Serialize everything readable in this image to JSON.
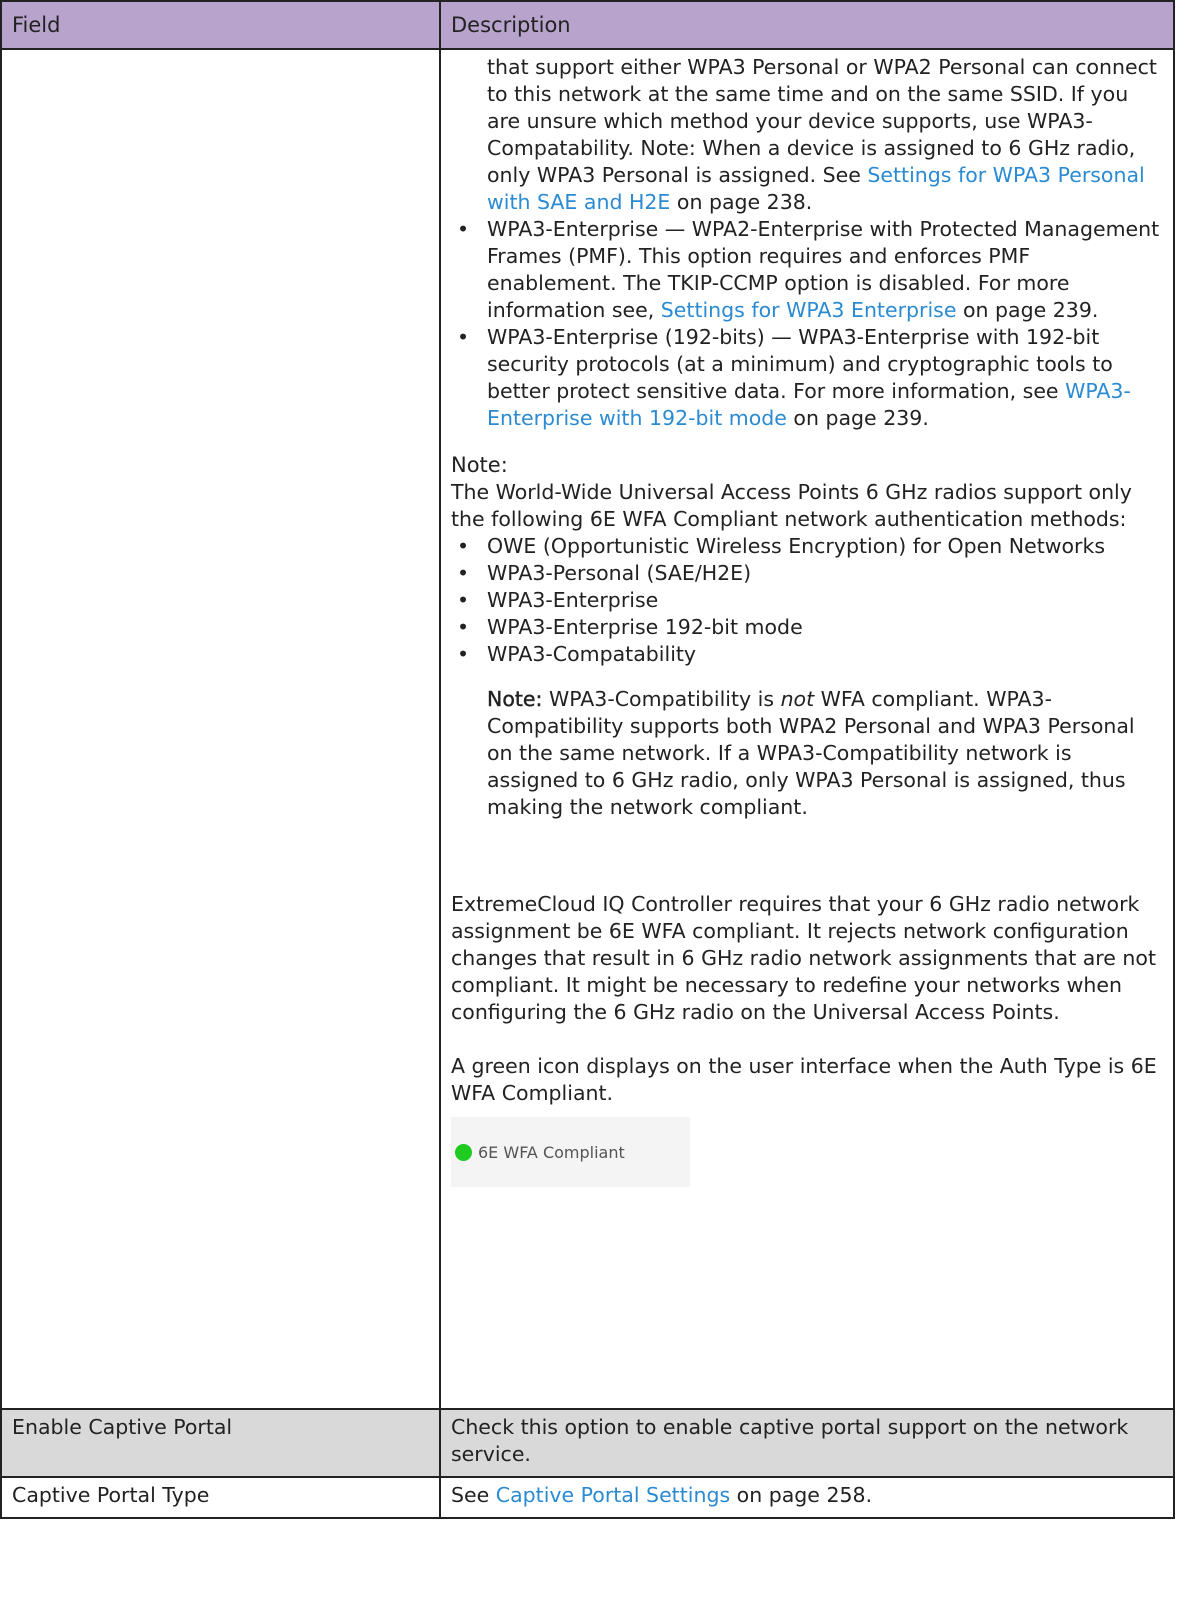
{
  "header": {
    "field": "Field",
    "description": "Description"
  },
  "row1": {
    "intro": "that support either WPA3 Personal or WPA2 Personal can connect to this network at the same time and on the same SSID. If you are unsure which method your device supports, use WPA3-Compatability. Note: When a device is assigned to 6 GHz radio, only WPA3 Personal is assigned. See ",
    "intro_link": "Settings for WPA3 Personal with SAE and H2E",
    "intro_tail": " on page 238.",
    "bullets": [
      {
        "text": "WPA3-Enterprise — WPA2-Enterprise with Protected Management Frames (PMF). This option requires and enforces PMF enablement. The TKIP-CCMP option is disabled. For more information see, ",
        "link": "Settings for WPA3 Enterprise",
        "tail": " on page 239."
      },
      {
        "text": "WPA3-Enterprise (192-bits) — WPA3-Enterprise with 192-bit security protocols (at a minimum) and cryptographic tools to better protect sensitive data. For more information, see ",
        "link": "WPA3-Enterprise with 192-bit mode",
        "tail": " on page 239."
      }
    ],
    "note_label": "Note:",
    "note_text": "The World-Wide Universal Access Points 6 GHz radios support only the following 6E WFA Compliant network authentication methods:",
    "methods": [
      "OWE (Opportunistic Wireless Encryption) for Open Networks",
      "WPA3-Personal (SAE/H2E)",
      "WPA3-Enterprise",
      "WPA3-Enterprise 192-bit mode",
      "WPA3-Compatability"
    ],
    "inner_note_label": "Note:",
    "inner_note_pre": " WPA3-Compatibility is ",
    "inner_note_em": "not",
    "inner_note_post": " WFA compliant. WPA3-Compatibility supports both WPA2 Personal and WPA3 Personal on the same network. If a WPA3-Compatibility network is assigned to 6 GHz radio, only WPA3 Personal is assigned, thus making the network compliant.",
    "para1": "ExtremeCloud IQ Controller requires that your 6 GHz radio network assignment be 6E WFA compliant. It rejects network configuration changes that result in 6 GHz radio network assignments that are not compliant. It might be necessary to redefine your networks when configuring the 6 GHz radio on the Universal Access Points.",
    "para2": "A green icon displays on the user interface when the Auth Type is 6E WFA Compliant.",
    "badge_text": "6E WFA Compliant"
  },
  "row2": {
    "field": "Enable Captive Portal",
    "description": "Check this option to enable captive portal support on the network service."
  },
  "row3": {
    "field": "Captive Portal Type",
    "pre": "See ",
    "link": "Captive Portal Settings",
    "tail": " on page 258."
  }
}
